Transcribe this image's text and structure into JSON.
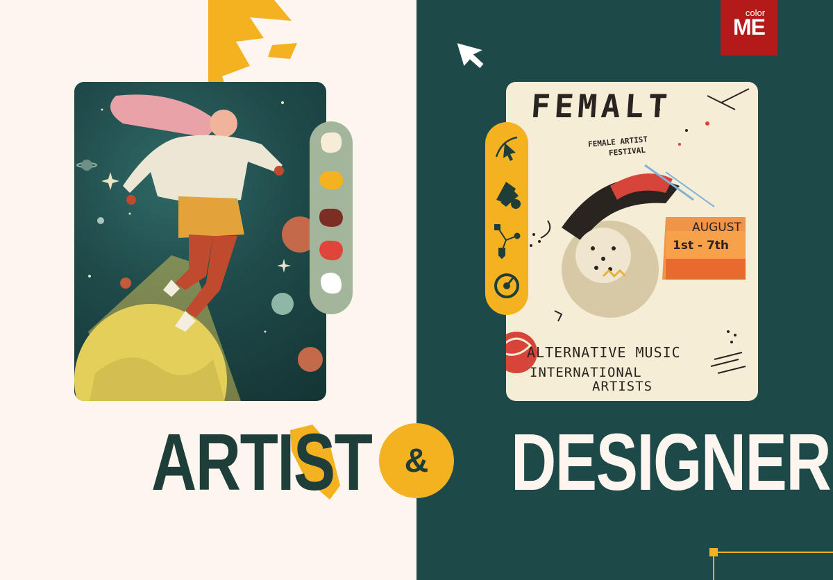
{
  "logo": {
    "small": "color",
    "big": "ME"
  },
  "headings": {
    "left": "ARTIST",
    "ampersand": "&",
    "right": "DESIGNER"
  },
  "poster": {
    "title": "FEMALT",
    "subtitle_line1": "FEMALE ARTIST",
    "subtitle_line2": "FESTIVAL",
    "date_line1": "AUGUST",
    "date_line2": "1st - 7th",
    "line_alternative": "ALTERNATIVE MUSIC",
    "line_international": "INTERNATIONAL",
    "line_artists": "ARTISTS"
  },
  "colors": {
    "left_bg": "#fdf6ee",
    "right_bg": "#1d4a48",
    "accent": "#f5b220",
    "dark_text": "#1f3d39",
    "logo_bg": "#b31b1b",
    "palette_swatches": [
      "#f7ecd8",
      "#f5b220",
      "#7a2e24",
      "#e0443a",
      "#ffffff"
    ]
  },
  "icons": {
    "cursor": "arrow-cursor-icon",
    "palette_swatches": [
      "paint-swatch-icon",
      "paint-swatch-icon",
      "paint-swatch-icon",
      "paint-swatch-icon",
      "paint-swatch-icon"
    ],
    "tools": [
      "pen-tool-icon",
      "swatches-tool-icon",
      "anchor-points-icon",
      "target-dial-icon"
    ]
  }
}
